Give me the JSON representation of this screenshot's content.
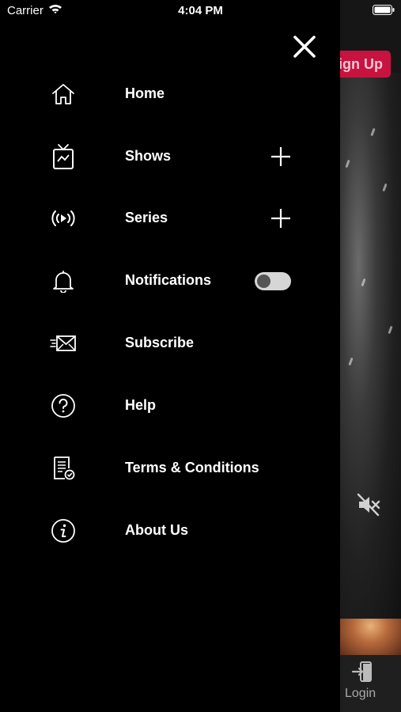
{
  "status_bar": {
    "carrier": "Carrier",
    "time": "4:04 PM",
    "wifi_icon": "wifi-icon",
    "battery_icon": "battery-icon"
  },
  "drawer": {
    "close_icon": "close-icon",
    "items": [
      {
        "label": "Home",
        "icon": "home-icon"
      },
      {
        "label": "Shows",
        "icon": "tv-icon",
        "expand_icon": "plus-icon"
      },
      {
        "label": "Series",
        "icon": "broadcast-play-icon",
        "expand_icon": "plus-icon"
      },
      {
        "label": "Notifications",
        "icon": "bell-icon",
        "toggle_on": false
      },
      {
        "label": "Subscribe",
        "icon": "mail-icon"
      },
      {
        "label": "Help",
        "icon": "question-icon"
      },
      {
        "label": "Terms & Conditions",
        "icon": "document-check-icon"
      },
      {
        "label": "About Us",
        "icon": "info-icon"
      }
    ]
  },
  "background_app": {
    "signup_label": "ign Up",
    "bottom_bar": {
      "login_label": "Login"
    },
    "colors": {
      "accent": "#c8123f"
    }
  }
}
